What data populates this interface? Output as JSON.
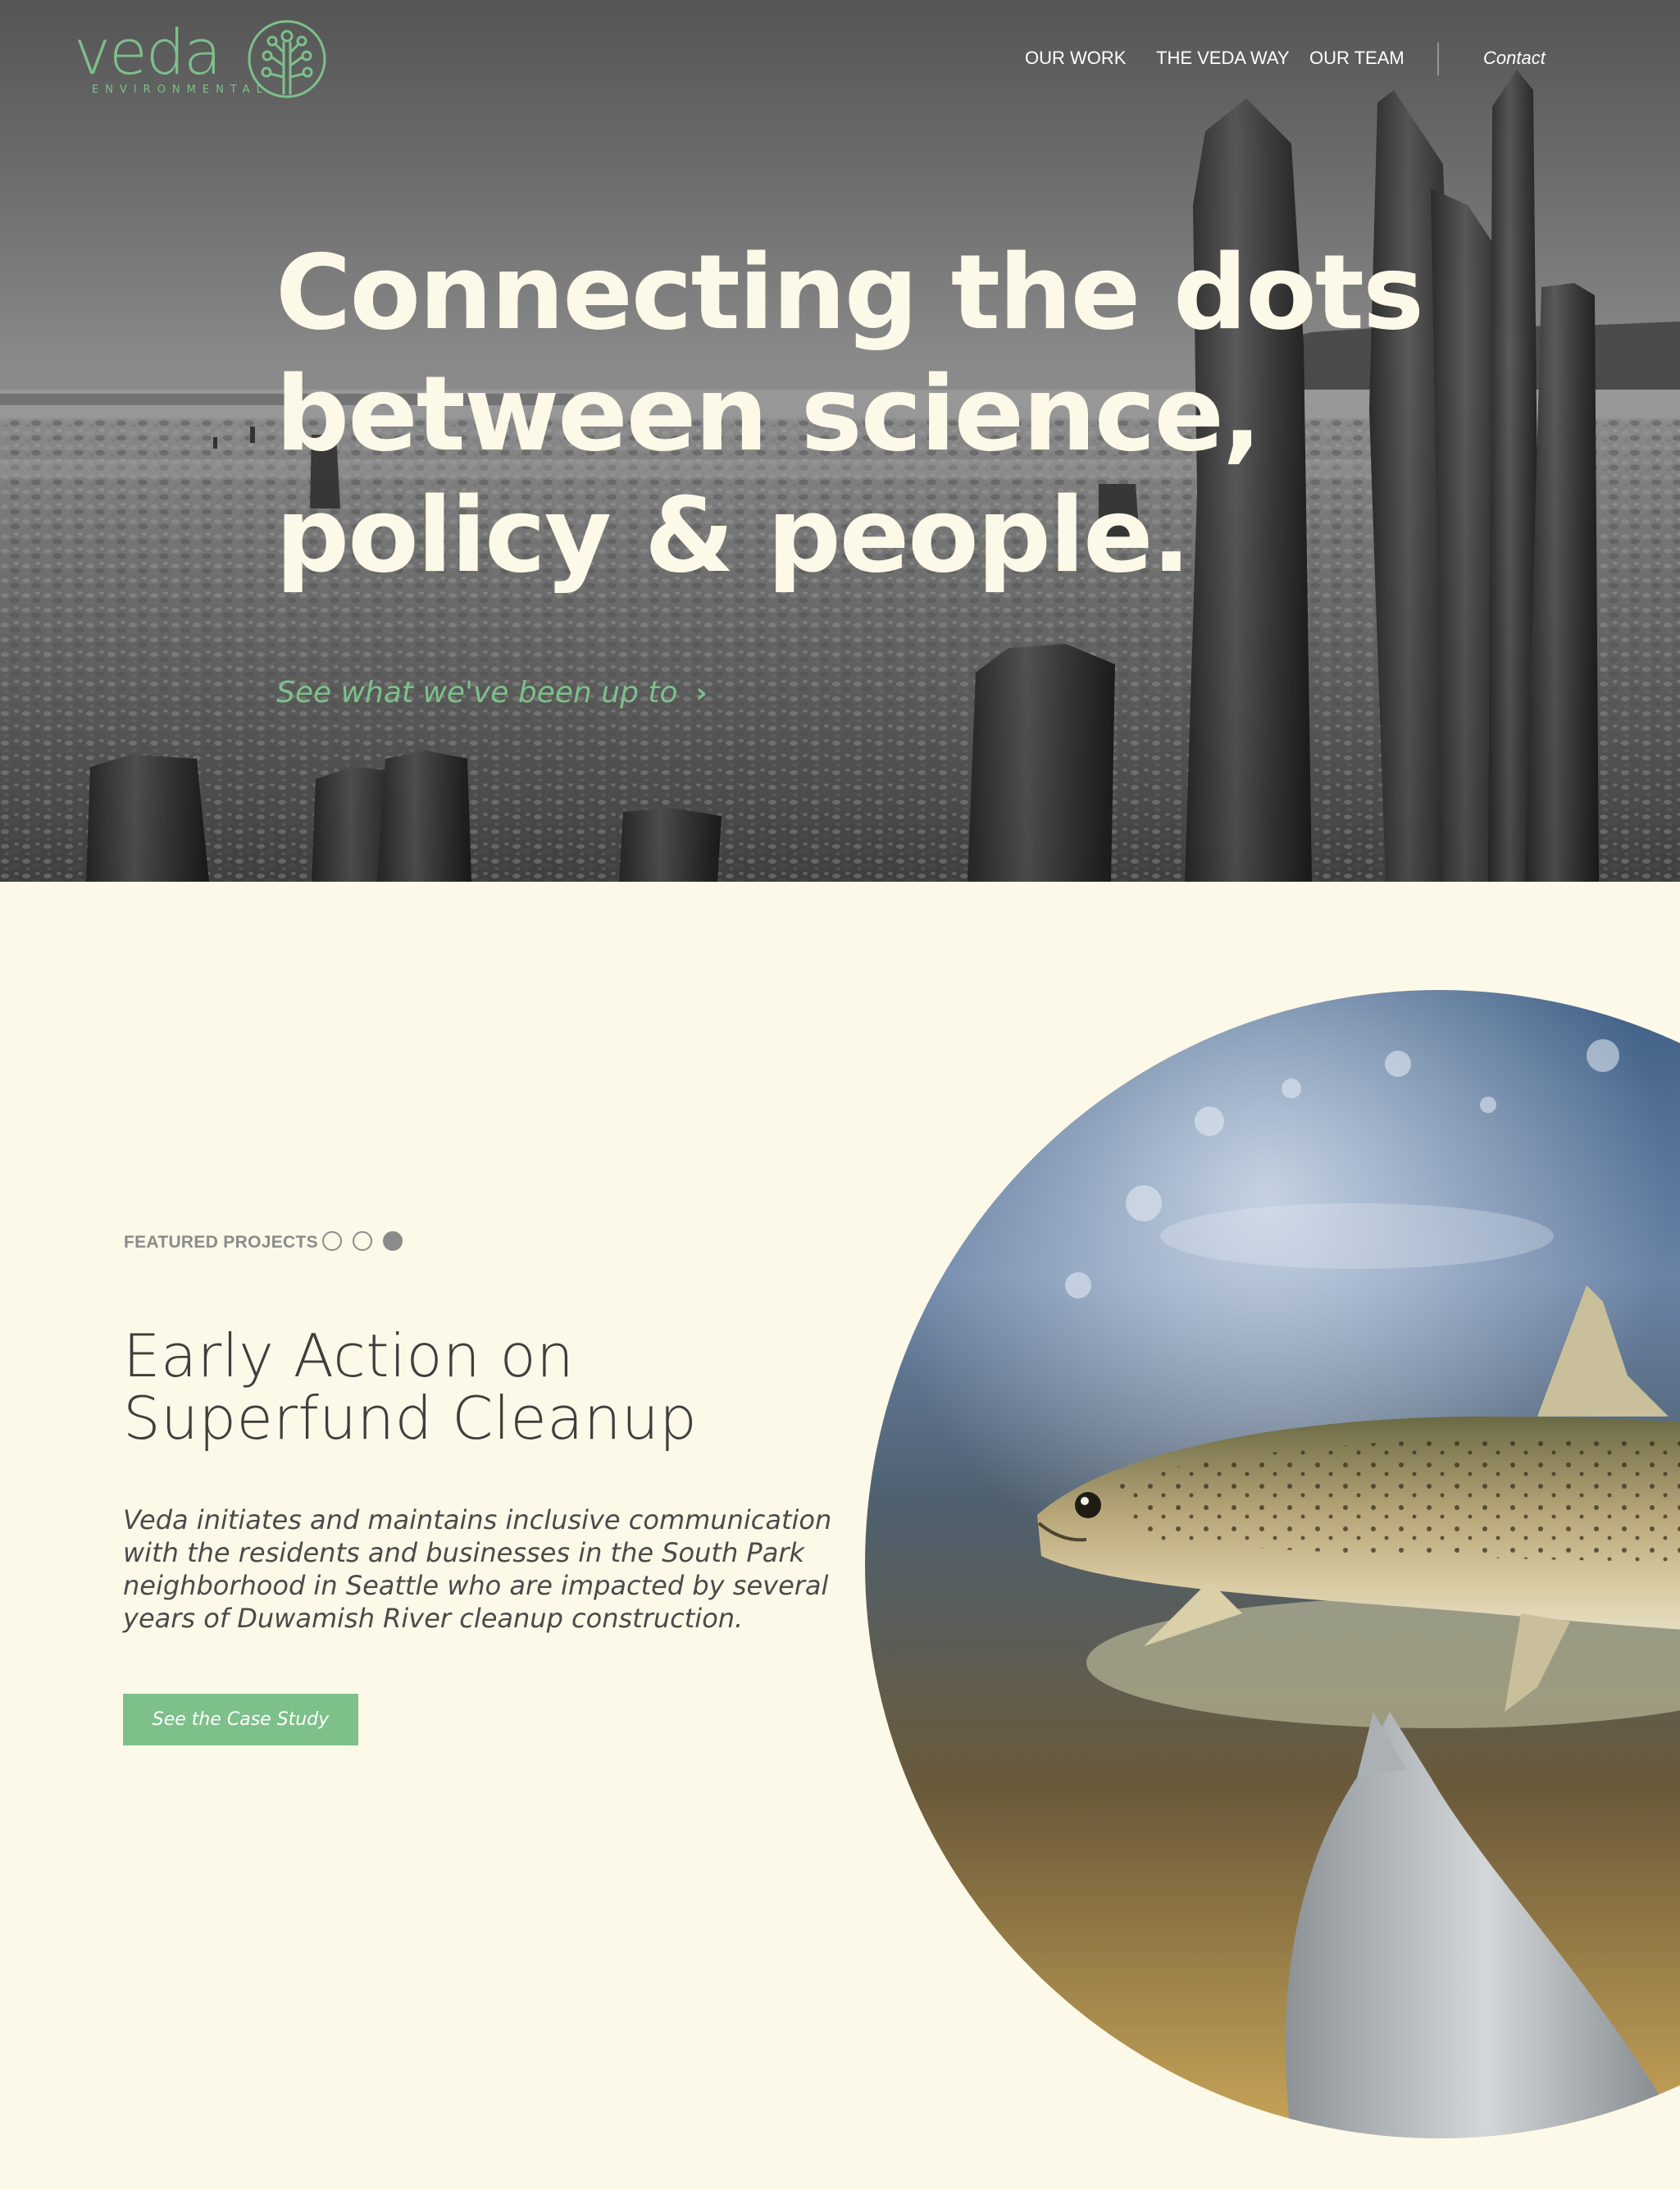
{
  "brand": {
    "name": "veda",
    "tagline": "ENVIRONMENTAL",
    "color": "#7dc08a"
  },
  "nav": {
    "items": [
      {
        "label": "OUR WORK"
      },
      {
        "label": "THE VEDA WAY"
      },
      {
        "label": "OUR TEAM"
      }
    ],
    "contact": "Contact"
  },
  "hero": {
    "headline_lines": [
      "Connecting the dots",
      "between science,",
      "policy & people."
    ],
    "link_label": "See what we've been up to",
    "link_icon": "chevron-right-icon"
  },
  "featured": {
    "eyebrow": "FEATURED PROJECTS",
    "dots": [
      {
        "active": false
      },
      {
        "active": false
      },
      {
        "active": true
      }
    ],
    "title_lines": [
      "Early Action on",
      "Superfund Cleanup"
    ],
    "body_lines": [
      "Veda initiates and maintains inclusive communication",
      "with the residents and businesses in the South Park",
      "neighborhood in Seattle who are impacted by several",
      "years of Duwamish River cleanup construction."
    ],
    "button_label": "See the Case Study"
  },
  "colors": {
    "cream": "#fdf9e8",
    "accent_green": "#7dc08a",
    "text_dark": "#3e3e3e",
    "muted_gray": "#8b8b8b"
  }
}
